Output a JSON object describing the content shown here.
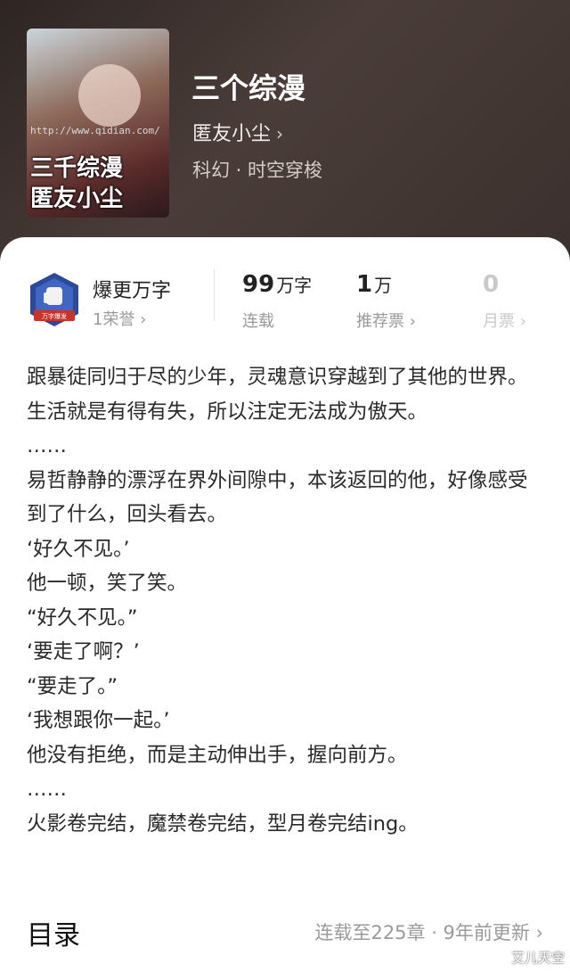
{
  "book": {
    "title": "三个综漫",
    "author": "匿友小尘",
    "author_chevron": "›",
    "genre": "科幻 · 时空穿梭",
    "cover": {
      "url_text": "http://www.qidian.com/",
      "title_line1": "三千综漫",
      "title_line2": "匿友小尘",
      "icon": "book-cover-image"
    }
  },
  "stats": {
    "honor": {
      "title": "爆更万字",
      "sub": "1荣誉 ›",
      "badge_text": "万字爆发"
    },
    "words": {
      "num": "99",
      "unit": "万字",
      "label": "连载"
    },
    "recommend": {
      "num": "1",
      "unit": "万",
      "label": "推荐票 ›"
    },
    "monthly": {
      "num": "0",
      "label": "月票 ›"
    }
  },
  "description": [
    "跟暴徒同归于尽的少年，灵魂意识穿越到了其他的世界。",
    "生活就是有得有失，所以注定无法成为傲天。",
    "……",
    "易哲静静的漂浮在界外间隙中，本该返回的他，好像感受到了什么，回头看去。",
    "‘好久不见。’",
    "他一顿，笑了笑。",
    "“好久不见。”",
    "‘要走了啊？’",
    "“要走了。”",
    "‘我想跟你一起。’",
    "他没有拒绝，而是主动伸出手，握向前方。",
    "……",
    "火影卷完结，魔禁卷完结，型月卷完结ing。"
  ],
  "toc": {
    "title": "目录",
    "info": "连载至225章 · 9年前更新 ›"
  },
  "watermark": "艾儿天空",
  "colors": {
    "hero_bg": "#3a2f2c",
    "card_bg": "#ffffff",
    "badge_blue": "#2c4a9a",
    "badge_red": "#c8342c"
  }
}
